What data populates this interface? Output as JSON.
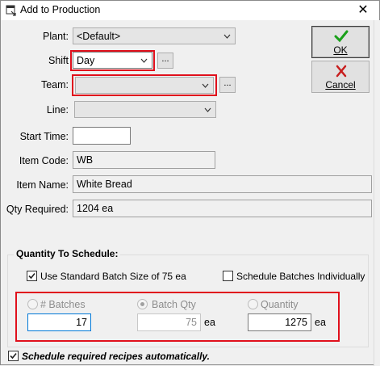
{
  "window": {
    "title": "Add to Production",
    "close_label": "✕"
  },
  "form": {
    "plant_label": "Plant:",
    "plant_value": "<Default>",
    "shift_label": "Shift",
    "shift_value": "Day",
    "team_label": "Team:",
    "team_value": "",
    "line_label": "Line:",
    "line_value": "",
    "browse_label": "...",
    "start_time_label": "Start Time:",
    "start_time_value": "",
    "item_code_label": "Item Code:",
    "item_code_value": "WB",
    "item_name_label": "Item Name:",
    "item_name_value": "White Bread",
    "qty_required_label": "Qty Required:",
    "qty_required_value": "1204 ea"
  },
  "buttons": {
    "ok_label": "OK",
    "ok_icon": "check-icon",
    "cancel_label": "Cancel",
    "cancel_icon": "x-icon"
  },
  "schedule": {
    "group_title": "Quantity To Schedule:",
    "use_standard_label": "Use Standard Batch Size of 75 ea",
    "use_standard_checked": true,
    "individually_label": "Schedule Batches Individually",
    "individually_checked": false,
    "batches_label": "# Batches",
    "batches_value": "17",
    "batch_qty_label": "Batch Qty",
    "batch_qty_value": "75",
    "batch_qty_unit": "ea",
    "quantity_label": "Quantity",
    "quantity_value": "1275",
    "quantity_unit": "ea",
    "selected_option": "Batch Qty"
  },
  "footer": {
    "auto_recipes_label": "Schedule required recipes automatically.",
    "auto_recipes_checked": true
  },
  "colors": {
    "highlight_red": "#e0101c",
    "ok_green": "#1aa01a",
    "cancel_red": "#c81e1e"
  }
}
